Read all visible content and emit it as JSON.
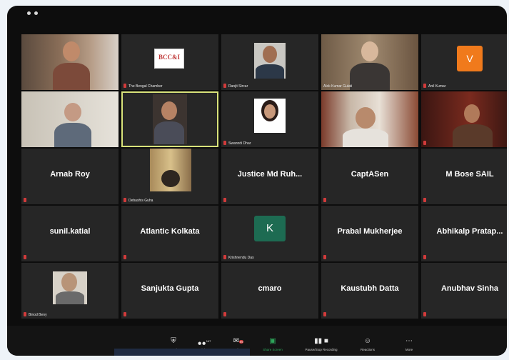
{
  "tiles": [
    {
      "name": "",
      "label": "",
      "mic": false
    },
    {
      "name": "",
      "label": "The Bengal Chamber",
      "mic": true
    },
    {
      "name": "",
      "label": "Ranjit Sircar",
      "mic": true
    },
    {
      "name": "",
      "label": "Alok Kumar Gulati",
      "mic": false
    },
    {
      "name": "",
      "label": "Anil Kumar",
      "mic": true
    },
    {
      "name": "",
      "label": "",
      "mic": false
    },
    {
      "name": "",
      "label": "",
      "mic": false
    },
    {
      "name": "",
      "label": "Swanndi Dhar",
      "mic": true
    },
    {
      "name": "",
      "label": "",
      "mic": false
    },
    {
      "name": "",
      "label": "",
      "mic": true
    },
    {
      "name": "Arnab Roy",
      "label": "",
      "mic": true
    },
    {
      "name": "",
      "label": "Debashis Guha",
      "mic": true
    },
    {
      "name": "Justice Md Ruh...",
      "label": "",
      "mic": true
    },
    {
      "name": "CaptASen",
      "label": "",
      "mic": true
    },
    {
      "name": "M Bose SAIL",
      "label": "",
      "mic": true
    },
    {
      "name": "sunil.katial",
      "label": "",
      "mic": true
    },
    {
      "name": "Atlantic Kolkata",
      "label": "",
      "mic": true
    },
    {
      "name": "",
      "label": "Krishnendu Das",
      "mic": true
    },
    {
      "name": "Prabal Mukherjee",
      "label": "",
      "mic": true
    },
    {
      "name": "Abhikalp Pratap...",
      "label": "",
      "mic": true
    },
    {
      "name": "",
      "label": "Binod Beny",
      "mic": true
    },
    {
      "name": "Sanjukta Gupta",
      "label": "",
      "mic": true
    },
    {
      "name": "cmaro",
      "label": "",
      "mic": true
    },
    {
      "name": "Kaustubh Datta",
      "label": "",
      "mic": true
    },
    {
      "name": "Anubhav Sinha",
      "label": "",
      "mic": true
    }
  ],
  "logo_text": "BCC&I",
  "avatar_v": "V",
  "avatar_k": "K",
  "toolbar": {
    "security": "Security",
    "participants": "Participants",
    "participants_count": "147",
    "chat": "Chat",
    "chat_badge": "99",
    "share": "Share Screen",
    "record": "Pause/Stop Recording",
    "reactions": "Reactions",
    "more": "More"
  },
  "colors": {
    "accent_green": "#2ea55a",
    "avatar_orange": "#f07a1c",
    "avatar_teal": "#1d6b52",
    "mic_red": "#d23b3b"
  }
}
